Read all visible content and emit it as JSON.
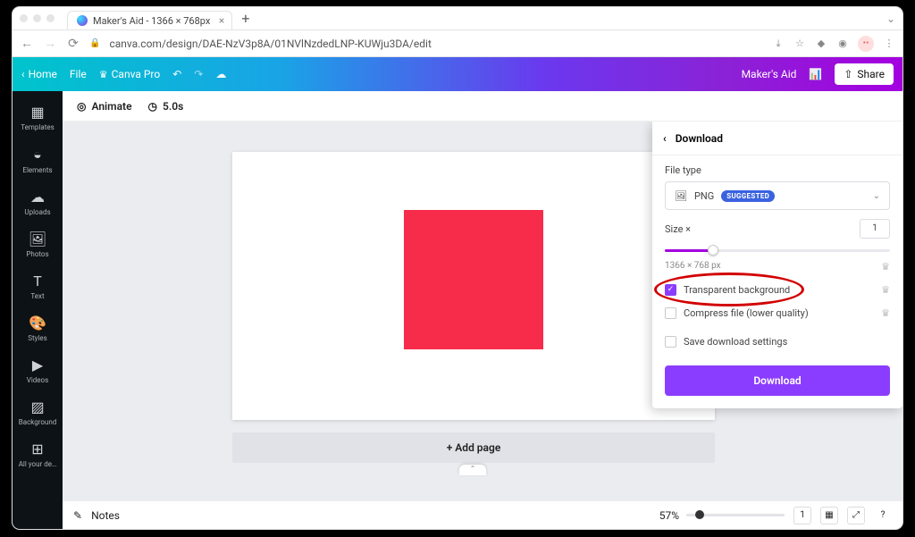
{
  "browser": {
    "tab_title": "Maker's Aid - 1366 × 768px",
    "url": "canva.com/design/DAE-NzV3p8A/01NVlNzdedLNP-KUWju3DA/edit"
  },
  "toolbar": {
    "home": "Home",
    "file": "File",
    "canva_pro": "Canva Pro",
    "project_name": "Maker's Aid",
    "share": "Share"
  },
  "subtoolbar": {
    "animate": "Animate",
    "duration": "5.0s"
  },
  "sidebar": {
    "items": [
      {
        "label": "Templates"
      },
      {
        "label": "Elements"
      },
      {
        "label": "Uploads"
      },
      {
        "label": "Photos"
      },
      {
        "label": "Text"
      },
      {
        "label": "Styles"
      },
      {
        "label": "Videos"
      },
      {
        "label": "Background"
      },
      {
        "label": "All your de…"
      }
    ]
  },
  "canvas": {
    "add_page": "+ Add page"
  },
  "download": {
    "header": "Download",
    "file_type_label": "File type",
    "file_type_value": "PNG",
    "suggested_badge": "SUGGESTED",
    "size_label": "Size ×",
    "size_value": "1",
    "dimensions": "1366 × 768 px",
    "opt_transparent": "Transparent background",
    "opt_compress": "Compress file (lower quality)",
    "opt_save": "Save download settings",
    "button": "Download"
  },
  "bottombar": {
    "notes": "Notes",
    "zoom": "57%",
    "page_index": "1"
  }
}
